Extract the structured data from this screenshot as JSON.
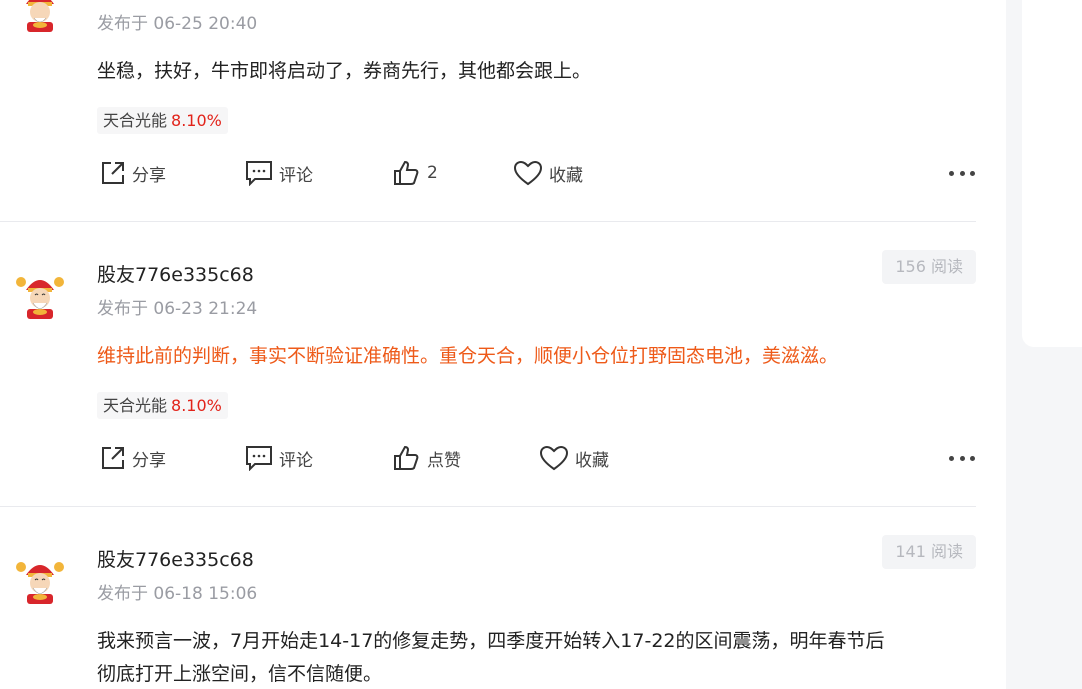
{
  "posts": [
    {
      "author": "",
      "time": "发布于 06-25 20:40",
      "reads": "",
      "content": "坐稳，扶好，牛市即将启动了，券商先行，其他都会跟上。",
      "content_color": "#222222",
      "stock": {
        "name": "天合光能",
        "change": "8.10%"
      },
      "actions": {
        "share": "分享",
        "comment": "评论",
        "like": "2",
        "favorite": "收藏"
      }
    },
    {
      "author": "股友776e335c68",
      "time": "发布于 06-23 21:24",
      "reads": "156 阅读",
      "content": "维持此前的判断，事实不断验证准确性。重仓天合，顺便小仓位打野固态电池，美滋滋。",
      "content_color": "#ee5a19",
      "stock": {
        "name": "天合光能",
        "change": "8.10%"
      },
      "actions": {
        "share": "分享",
        "comment": "评论",
        "like": "点赞",
        "favorite": "收藏"
      }
    },
    {
      "author": "股友776e335c68",
      "time": "发布于 06-18 15:06",
      "reads": "141 阅读",
      "content_line1": "我来预言一波，7月开始走14-17的修复走势，四季度开始转入17-22的区间震荡，明年春节后",
      "content_line2": "彻底打开上涨空间，信不信随便。",
      "content_color": "#222222"
    }
  ],
  "colors": {
    "accent_orange": "#ee5a19",
    "stock_up_red": "#e2231a",
    "muted_gray": "#9a9ca3"
  },
  "icons": [
    "avatar-caishen",
    "share-icon",
    "comment-icon",
    "thumbs-up-icon",
    "heart-icon",
    "more-icon"
  ]
}
